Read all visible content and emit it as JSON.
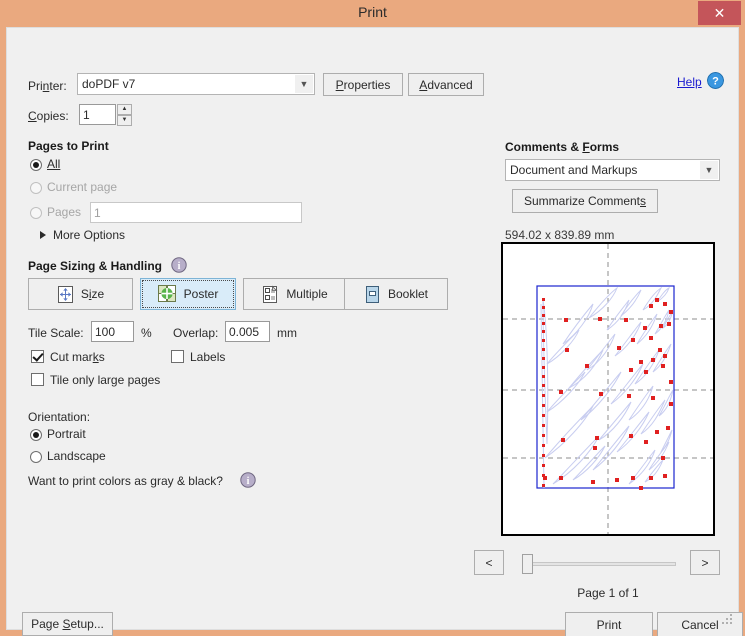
{
  "window": {
    "title": "Print",
    "close_label": "✕"
  },
  "printer": {
    "label": "Printer:",
    "label_pre": "Pri",
    "label_mnem": "n",
    "label_post": "ter:",
    "value": "doPDF v7",
    "properties_label": "Properties",
    "advanced_label": "Advanced",
    "help_label": "Help",
    "help_icon": "help-circle-icon",
    "dropdown_icon": "chevron-down-icon"
  },
  "copies": {
    "label": "Copies:",
    "value": "1",
    "up_icon": "spinner-up-icon",
    "down_icon": "spinner-down-icon"
  },
  "pages_to_print": {
    "title": "Pages to Print",
    "options": [
      {
        "label": "All",
        "selected": true,
        "disabled": false
      },
      {
        "label": "Current page",
        "selected": false,
        "disabled": true
      },
      {
        "label": "Pages",
        "selected": false,
        "disabled": true
      }
    ],
    "pages_value": "1",
    "more_options_label": "More Options",
    "more_options_icon": "triangle-right-icon"
  },
  "page_sizing": {
    "title": "Page Sizing & Handling",
    "info_icon": "info-icon",
    "modes": [
      {
        "label": "Size",
        "icon": "resize-page-icon",
        "selected": false
      },
      {
        "label": "Poster",
        "icon": "poster-tiles-icon",
        "selected": true
      },
      {
        "label": "Multiple",
        "icon": "multiple-pages-icon",
        "selected": false
      },
      {
        "label": "Booklet",
        "icon": "booklet-icon",
        "selected": false
      }
    ],
    "tile_scale_label": "Tile Scale:",
    "tile_scale_value": "100",
    "tile_scale_unit": "%",
    "overlap_label": "Overlap:",
    "overlap_value": "0.005",
    "overlap_unit": "mm",
    "checkboxes": [
      {
        "label": "Cut marks",
        "checked": true
      },
      {
        "label": "Labels",
        "checked": false
      },
      {
        "label": "Tile only large pages",
        "checked": false
      }
    ]
  },
  "orientation": {
    "title": "Orientation:",
    "options": [
      {
        "label": "Portrait",
        "selected": true
      },
      {
        "label": "Landscape",
        "selected": false
      }
    ],
    "gray_question": "Want to print colors as gray & black?",
    "gray_info_icon": "info-icon"
  },
  "comments_forms": {
    "title": "Comments & Forms",
    "value": "Document and Markups",
    "summarize_label": "Summarize Comments",
    "dropdown_icon": "chevron-down-icon"
  },
  "preview": {
    "dimensions": "594.02 x 839.89 mm",
    "page_label": "Page 1 of 1",
    "prev_label": "<",
    "next_label": ">",
    "slider_position_percent": 0
  },
  "footer": {
    "page_setup_label": "Page Setup...",
    "print_label": "Print",
    "cancel_label": "Cancel"
  },
  "colors": {
    "titlebar": "#eaa97f",
    "close_button": "#c4555a",
    "dialog_body": "#f0f0f0",
    "selected_mode": "#d9ecf9",
    "help_link": "#1a1ad0",
    "preview_plot_line": "#c8cdf0",
    "preview_marker": "#e02020",
    "preview_page_border": "#1c24cf"
  }
}
